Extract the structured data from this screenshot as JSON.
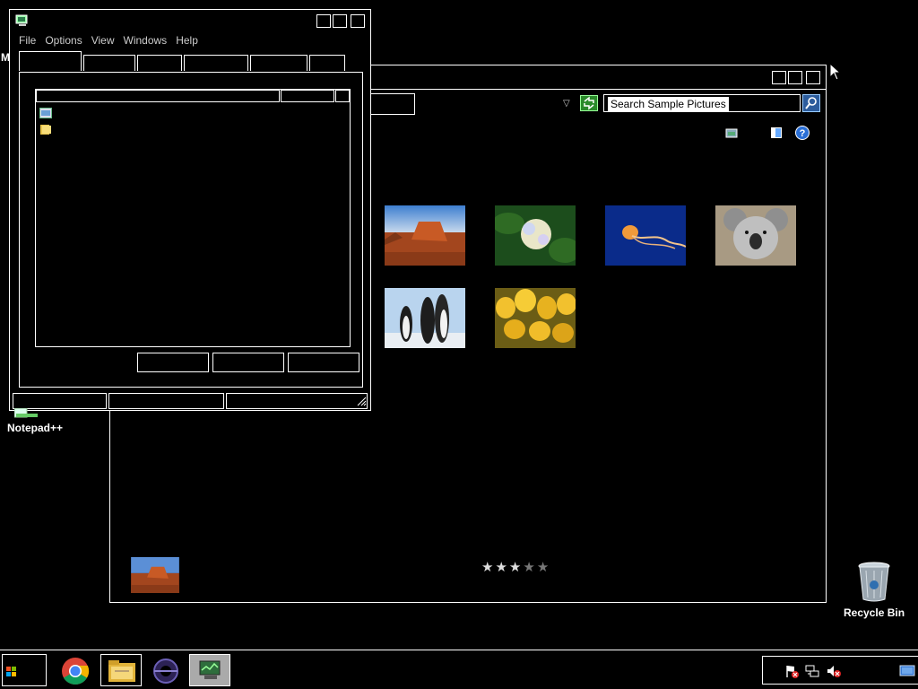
{
  "explorer": {
    "search_placeholder": "Search Sample Pictures",
    "rating": {
      "value": 3,
      "max": 5
    },
    "thumbnails": [
      "desert",
      "hydrangeas",
      "jellyfish",
      "koala",
      "penguins",
      "tulips"
    ],
    "preview": "desert"
  },
  "manager": {
    "menu": [
      "File",
      "Options",
      "View",
      "Windows",
      "Help"
    ]
  },
  "desktop": {
    "icons": [
      {
        "label": "Notepad++"
      },
      {
        "label": "Recycle Bin"
      }
    ],
    "clipped_label": "M"
  },
  "taskbar": {
    "items": [
      "start-orb-icon",
      "chrome-icon",
      "file-explorer-icon",
      "eclipse-icon",
      "task-manager-icon"
    ],
    "tray": [
      "action-center-flag-icon",
      "network-icon",
      "volume-muted-icon",
      "show-desktop-icon"
    ]
  },
  "colors": {
    "background": "#000000",
    "foreground": "#ffffff",
    "refresh": "#2a8a2a",
    "search_button": "#2c5c9c"
  }
}
